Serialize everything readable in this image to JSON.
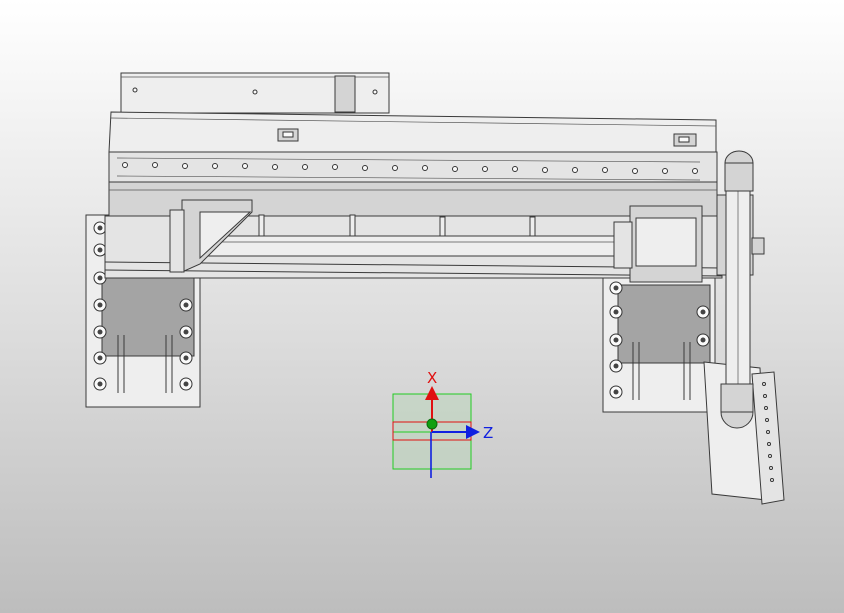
{
  "viewport": {
    "background_top": "#ffffff",
    "background_bottom": "#bdbdbd"
  },
  "triad": {
    "x_label": "X",
    "z_label": "Z",
    "x_color": "#e01010",
    "z_color": "#1020e0",
    "y_color": "#10a010",
    "frame_color": "#22cc22"
  }
}
